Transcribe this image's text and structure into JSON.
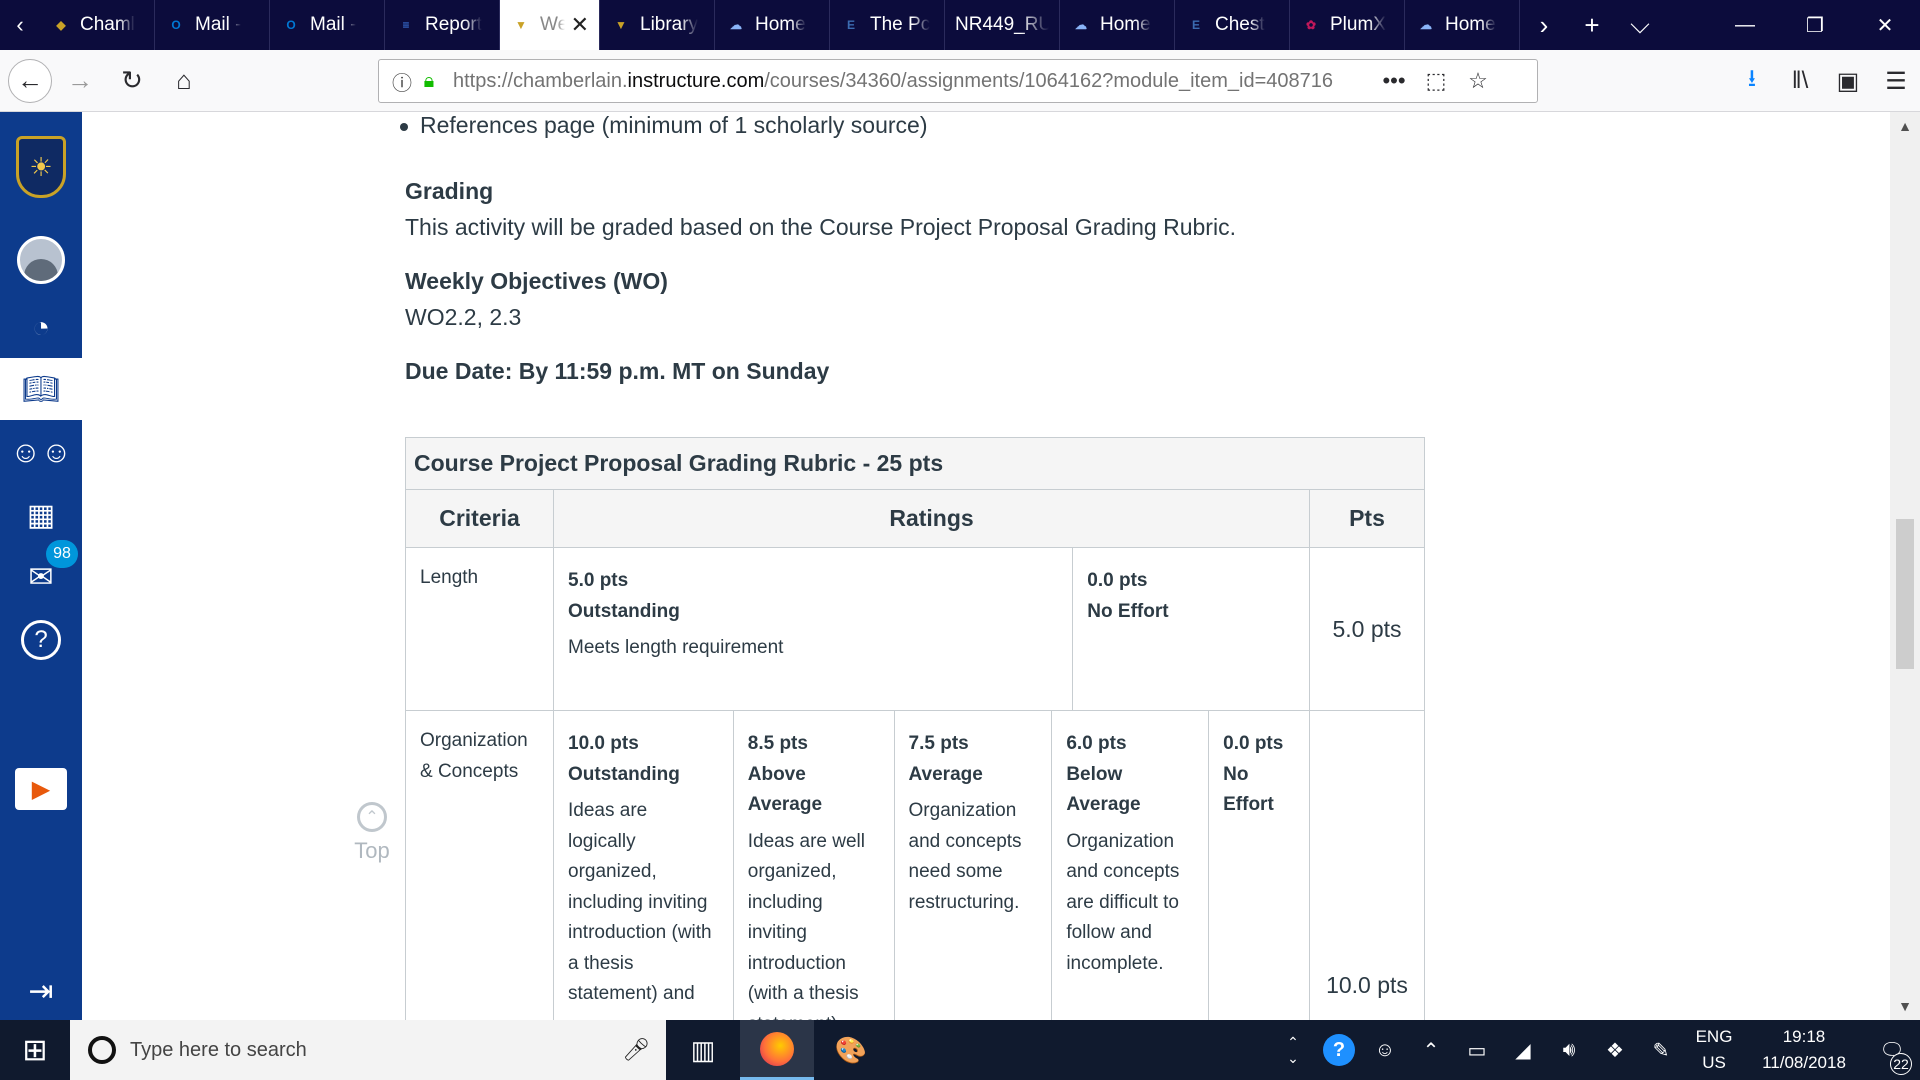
{
  "browser": {
    "tabs": [
      {
        "label": "Chaml",
        "icon": "shield-icon",
        "icon_color": "#c9a227"
      },
      {
        "label": "Mail -",
        "icon": "outlook-icon",
        "icon_color": "#0078d4"
      },
      {
        "label": "Mail -",
        "icon": "outlook-icon",
        "icon_color": "#0078d4"
      },
      {
        "label": "Report",
        "icon": "docs-icon",
        "icon_color": "#4285f4"
      },
      {
        "label": "We",
        "icon": "chamberlain-icon",
        "icon_color": "#c9a227",
        "active": true
      },
      {
        "label": "Library",
        "icon": "chamberlain-icon",
        "icon_color": "#c9a227"
      },
      {
        "label": "Home",
        "icon": "cloud-icon",
        "icon_color": "#8ab4f8"
      },
      {
        "label": "The Pc",
        "icon": "ebsco-icon",
        "icon_color": "#3b6bb0"
      },
      {
        "label": "NR449_RU",
        "icon": "none",
        "icon_color": ""
      },
      {
        "label": "Home",
        "icon": "cloud-icon",
        "icon_color": "#8ab4f8"
      },
      {
        "label": "Chest",
        "icon": "ebsco-icon",
        "icon_color": "#3b6bb0"
      },
      {
        "label": "PlumX",
        "icon": "plumx-icon",
        "icon_color": "#c2185b"
      },
      {
        "label": "Home",
        "icon": "cloud-icon",
        "icon_color": "#8ab4f8"
      }
    ],
    "url_prefix": "https://chamberlain.",
    "url_domain": "instructure.com",
    "url_path": "/courses/34360/assignments/1064162?module_item_id=408716"
  },
  "sidebar": {
    "inbox_badge": "98"
  },
  "content": {
    "reference_bullet": "References page (minimum of 1 scholarly source)",
    "grading_heading": "Grading",
    "grading_text": "This activity will be graded based on the Course Project Proposal Grading Rubric.",
    "wo_heading": "Weekly Objectives (WO)",
    "wo_text": "WO2.2, 2.3",
    "due_date": "Due Date: By 11:59 p.m. MT on Sunday",
    "top_label": "Top"
  },
  "rubric": {
    "title": "Course Project Proposal Grading Rubric - 25 pts",
    "headers": {
      "criteria": "Criteria",
      "ratings": "Ratings",
      "pts": "Pts"
    },
    "rows": [
      {
        "criterion": "Length",
        "ratings": [
          {
            "pts": "5.0 pts",
            "label": "Outstanding",
            "desc": "Meets length requirement"
          },
          {
            "pts": "0.0 pts",
            "label": "No Effort",
            "desc": ""
          }
        ],
        "points": "5.0 pts"
      },
      {
        "criterion": "Organization & Concepts",
        "ratings": [
          {
            "pts": "10.0 pts",
            "label": "Outstanding",
            "desc": "Ideas are logically organized, including inviting introduction (with a thesis statement) and"
          },
          {
            "pts": "8.5 pts",
            "label": "Above Average",
            "desc": "Ideas are well organized, including inviting introduction (with a thesis statement),"
          },
          {
            "pts": "7.5 pts",
            "label": "Average",
            "desc": "Organization and concepts need some restructuring."
          },
          {
            "pts": "6.0 pts",
            "label": "Below Average",
            "desc": "Organization and concepts are difficult to follow and incomplete."
          },
          {
            "pts": "0.0 pts",
            "label": "No Effort",
            "desc": ""
          }
        ],
        "points": "10.0 pts"
      }
    ]
  },
  "taskbar": {
    "search_placeholder": "Type here to search",
    "lang_top": "ENG",
    "lang_bottom": "US",
    "time": "19:18",
    "date": "11/08/2018",
    "notifications": "22"
  }
}
